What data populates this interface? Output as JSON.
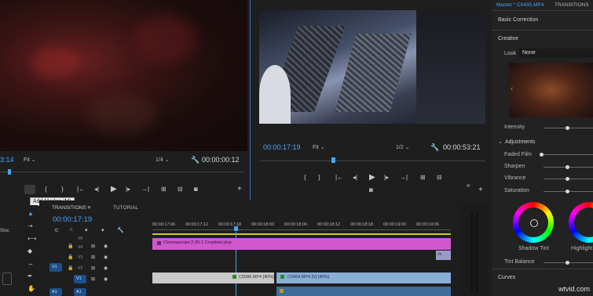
{
  "source_monitor": {
    "timecode_left": "3:14",
    "fit": "Fit",
    "fraction": "1/4",
    "duration": "00:00:00:12",
    "tooltip": "Add Marker (M)"
  },
  "program_monitor": {
    "timecode": "00:00:17:19",
    "fit": "Fit",
    "fraction": "1/2",
    "duration": "00:00:53:21"
  },
  "lumetri": {
    "tab_master": "Master * C0435.MP4",
    "tab_transitions": "TRANSITIONS",
    "basic_correction": "Basic Correction",
    "creative": "Creative",
    "look_label": "Look",
    "look_value": "None",
    "intensity": "Intensity",
    "adjustments": "Adjustments",
    "faded_film": "Faded Film",
    "sharpen": "Sharpen",
    "vibrance": "Vibrance",
    "saturation": "Saturation",
    "shadow_tint": "Shadow Tint",
    "highlight_tint": "Highlight",
    "tint_balance": "Tint Balance",
    "curves": "Curves"
  },
  "timeline": {
    "tab_transitions": "TRANSITIONS",
    "tab_tutorial": "TUTORIAL",
    "timecode": "00:00:17:19",
    "ruler": [
      "00:00:17:06",
      "00:00:17:12",
      "00:00:17:18",
      "00:00:18:00",
      "00:00:18:06",
      "00:00:18:12",
      "00:00:18:18",
      "00:00:19:00",
      "00:00:19:06"
    ],
    "tracks": [
      "V5",
      "V4",
      "V3",
      "V2",
      "V1",
      "A1"
    ],
    "v1_target": "V1",
    "a1_target": "A1",
    "clip_png": "Cinemascope 2-35-1 Croplines.png",
    "clip_1": "C0086.MP4 [40%]",
    "clip_2": "C0064.MP4 [V] [40%]",
    "fx": "fx",
    "stock": "Stoc"
  },
  "watermark": "wtvid.com"
}
